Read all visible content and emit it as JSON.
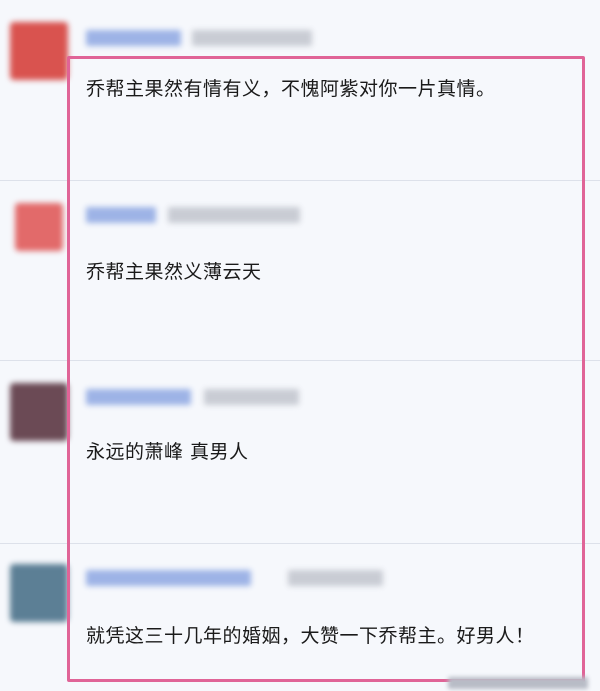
{
  "comments": [
    {
      "text": "乔帮主果然有情有义，不愧阿紫对你一片真情。",
      "avatar_color": "#d9534f"
    },
    {
      "text": "乔帮主果然义薄云天",
      "avatar_color": "#e26a6a"
    },
    {
      "text": "永远的萧峰  真男人",
      "avatar_color": "#6b4a55"
    },
    {
      "text": "就凭这三十几年的婚姻，大赞一下乔帮主。好男人！",
      "avatar_color": "#5c7f95"
    }
  ],
  "colors": {
    "highlight_border": "#e06497",
    "background": "#f6f8fc",
    "name_blur": "#9db3e6",
    "meta_blur": "#c9ccd4"
  }
}
